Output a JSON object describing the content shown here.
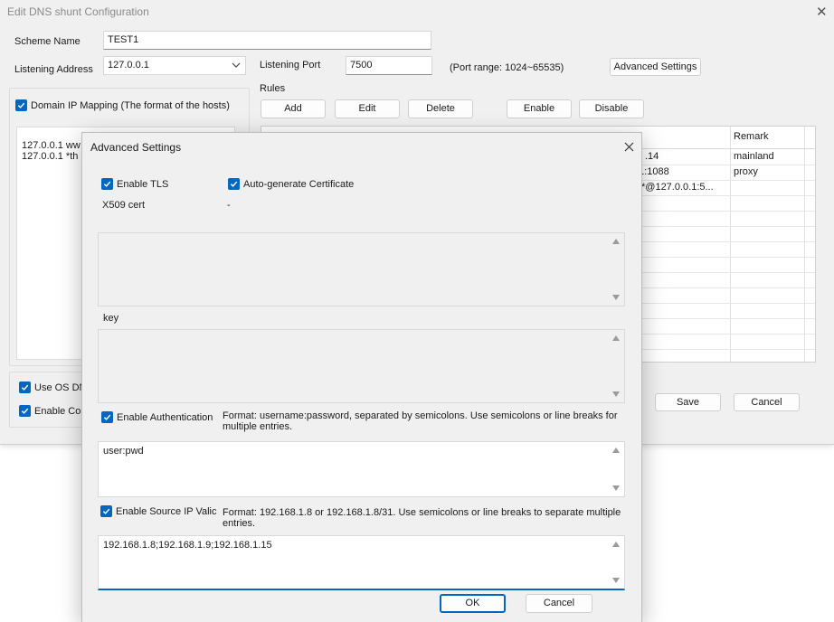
{
  "main_window": {
    "title": "Edit DNS shunt Configuration",
    "scheme_name_label": "Scheme Name",
    "scheme_name_value": "TEST1",
    "listening_address_label": "Listening Address",
    "listening_address_value": "127.0.0.1",
    "listening_port_label": "Listening Port",
    "listening_port_value": "7500",
    "port_range_text": "(Port range: 1024~65535)",
    "advanced_settings_button": "Advanced Settings",
    "domain_ip_mapping_label": "Domain IP Mapping (The format of the hosts)",
    "hosts_lines": [
      "127.0.0.1 ww",
      "127.0.0.1 *th"
    ],
    "use_os_dns_label": "Use OS DNS",
    "enable_con_label": "Enable Con",
    "rules_label": "Rules",
    "buttons": {
      "add": "Add",
      "edit": "Edit",
      "delete": "Delete",
      "enable": "Enable",
      "disable": "Disable",
      "save": "Save",
      "cancel": "Cancel"
    },
    "table": {
      "remark_header": "Remark",
      "rows": [
        {
          "partial": ".14",
          "remark": "mainland"
        },
        {
          "partial": ".1:1088",
          "remark": "proxy"
        },
        {
          "partial": "*@127.0.0.1:5...",
          "remark": ""
        }
      ]
    }
  },
  "advanced_dialog": {
    "title": "Advanced Settings",
    "enable_tls_label": "Enable TLS",
    "auto_cert_label": "Auto-generate Certificate",
    "x509_label": "X509 cert",
    "x509_value": "-",
    "key_label": "key",
    "enable_auth_label": "Enable Authentication",
    "auth_format_line1": "Format: username:password, separated by semicolons. Use semicolons or line breaks for",
    "auth_format_line2": "multiple entries.",
    "auth_value": "user:pwd",
    "enable_source_ip_label": "Enable Source IP Valic",
    "ip_format_line1": "Format: 192.168.1.8 or 192.168.1.8/31. Use semicolons or line breaks to separate multiple",
    "ip_format_line2": "entries.",
    "ip_value": "192.168.1.8;192.168.1.9;192.168.1.15",
    "ok_button": "OK",
    "cancel_button": "Cancel"
  },
  "colors": {
    "accent": "#0067c0",
    "window_bg": "#f0f0f0"
  }
}
